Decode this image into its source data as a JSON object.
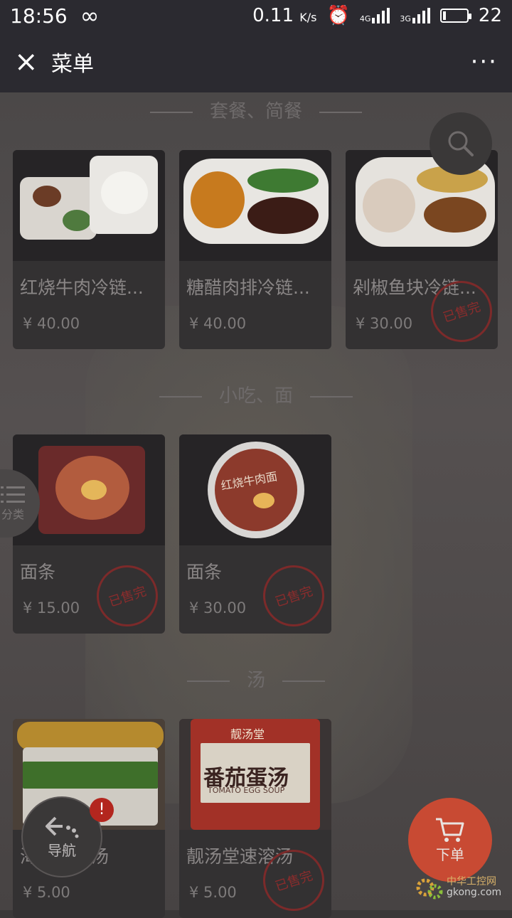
{
  "status_bar": {
    "time": "18:56",
    "infinity": "∞",
    "speed": "0.11",
    "speed_unit": "K/s",
    "net1": "4G",
    "net2": "3G",
    "battery": "22"
  },
  "header": {
    "close_label": "×",
    "title": "菜单",
    "more_label": "···"
  },
  "sections": {
    "set_meals": {
      "title": "套餐、简餐"
    },
    "noodles": {
      "title": "小吃、面"
    },
    "soup": {
      "title": "汤"
    }
  },
  "items": [
    {
      "name": "红烧牛肉冷链...",
      "price": "¥ 40.00"
    },
    {
      "name": "糖醋肉排冷链...",
      "price": "¥ 40.00"
    },
    {
      "name": "剁椒鱼块冷链...",
      "price": "¥ 30.00",
      "sold_out": "已售完"
    },
    {
      "name": "面条",
      "price": "¥ 15.00",
      "sold_out": "已售完"
    },
    {
      "name": "面条",
      "price": "¥ 30.00",
      "sold_out": "已售完"
    },
    {
      "name": "海鲜速溶汤",
      "price": "¥ 5.00"
    },
    {
      "name": "靓汤堂速溶汤",
      "price": "¥ 5.00",
      "sold_out": "已售完"
    }
  ],
  "product_text": {
    "soup_brand": "靓汤堂",
    "soup_title": "番茄蛋汤",
    "soup_subtitle": "TOMATO EGG SOUP",
    "noodle_label": "红烧牛肉面"
  },
  "floating": {
    "category_label": "分类",
    "nav_label": "导航",
    "nav_badge": "!",
    "order_label": "下单"
  },
  "watermark": {
    "site": "中华工控网",
    "domain": "gkong.com"
  },
  "colors": {
    "accent": "#c84a33",
    "stamp": "#8b2c2c"
  }
}
